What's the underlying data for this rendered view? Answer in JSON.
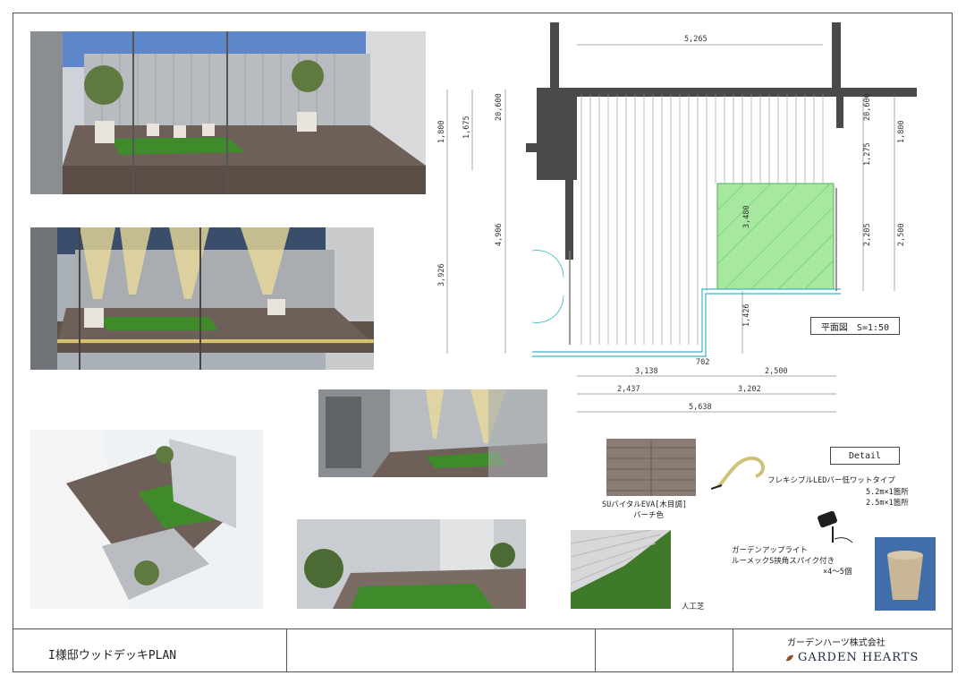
{
  "plan": {
    "dims": {
      "top_width": "5,265",
      "left_outer": "1,800",
      "left_inner": "1,675",
      "left_small": "20,600",
      "right_small": "20,600",
      "right_outer": "1,800",
      "right_mid": "1,275",
      "lawn_width": "3,480",
      "lawn_height": "2,205",
      "right_lower": "2,500",
      "left_total": "3,926",
      "left_deck": "4,906",
      "lower_mid": "1,426",
      "bottom_step": "702",
      "bottom_a1": "3,138",
      "bottom_a2": "2,500",
      "bottom_b1": "2,437",
      "bottom_b2": "3,202",
      "bottom_total": "5,638"
    },
    "scale_label": "平面図　S=1:50"
  },
  "detail": {
    "label": "Detail",
    "wood_caption_1": "SUバイタルEVA[木目調]",
    "wood_caption_2": "バーチ色",
    "led_caption_1": "フレキシブルLEDバー低ワットタイプ",
    "led_caption_2": "5.2m×1箇所",
    "led_caption_3": "2.5m×1箇所",
    "light_caption_1": "ガーデンアップライト",
    "light_caption_2": "ルーメックS挟角スパイク付き",
    "light_caption_3": "×4～5個",
    "turf_caption": "人工芝"
  },
  "title_block": {
    "title": "I様邸ウッドデッキPLAN",
    "company": "ガーデンハーツ株式会社",
    "brand": "GARDEN HEARTS"
  },
  "colors": {
    "lawn_plan": "#a6e8a0",
    "wall_plan": "#4a4a4a",
    "deck": "#6e6058",
    "grass": "#3f8a2a",
    "sky": "#5d87c8",
    "fence": "#b8bcc0"
  }
}
